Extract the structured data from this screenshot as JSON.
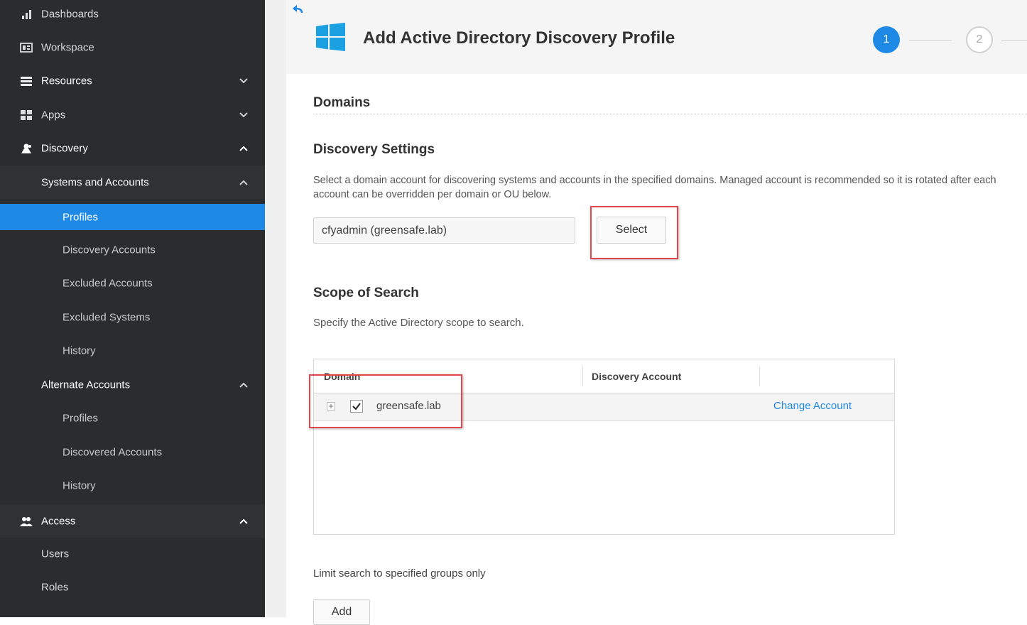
{
  "sidebar": {
    "items": [
      {
        "label": "Dashboards",
        "icon": "bar-chart-icon"
      },
      {
        "label": "Workspace",
        "icon": "workspace-icon"
      },
      {
        "label": "Resources",
        "icon": "list-icon"
      },
      {
        "label": "Apps",
        "icon": "apps-grid-icon"
      },
      {
        "label": "Discovery",
        "icon": "discovery-icon"
      },
      {
        "label": "Systems and Accounts"
      },
      {
        "label": "Profiles"
      },
      {
        "label": "Discovery Accounts"
      },
      {
        "label": "Excluded Accounts"
      },
      {
        "label": "Excluded Systems"
      },
      {
        "label": "History"
      },
      {
        "label": "Alternate Accounts"
      },
      {
        "label": "Profiles"
      },
      {
        "label": "Discovered Accounts"
      },
      {
        "label": "History"
      },
      {
        "label": "Access",
        "icon": "users-icon"
      },
      {
        "label": "Users"
      },
      {
        "label": "Roles"
      }
    ],
    "active_color": "#1e88e5",
    "background": "#2a2c2e"
  },
  "header": {
    "title": "Add Active Directory Discovery Profile",
    "steps": [
      "1",
      "2"
    ],
    "current_step": 1
  },
  "domains": {
    "heading": "Domains"
  },
  "discovery_settings": {
    "heading": "Discovery Settings",
    "description_line1": "Select a domain account for discovering systems and accounts in the specified domains. Managed account is recommended so it is rotated after each",
    "description_line2": "account can be overridden per domain or OU below.",
    "account_value": "cfyadmin (greensafe.lab)",
    "select_label": "Select"
  },
  "scope": {
    "heading": "Scope of Search",
    "description": "Specify the Active Directory scope to search.",
    "table": {
      "columns": [
        "Domain",
        "Discovery Account",
        ""
      ],
      "rows": [
        {
          "domain": "greensafe.lab",
          "checked": true,
          "discovery_account": "",
          "action": "Change Account"
        }
      ]
    }
  },
  "groups": {
    "label": "Limit search to specified groups only",
    "add_label": "Add"
  },
  "accent_color": "#1e88e5",
  "highlight_color": "#e0464b"
}
